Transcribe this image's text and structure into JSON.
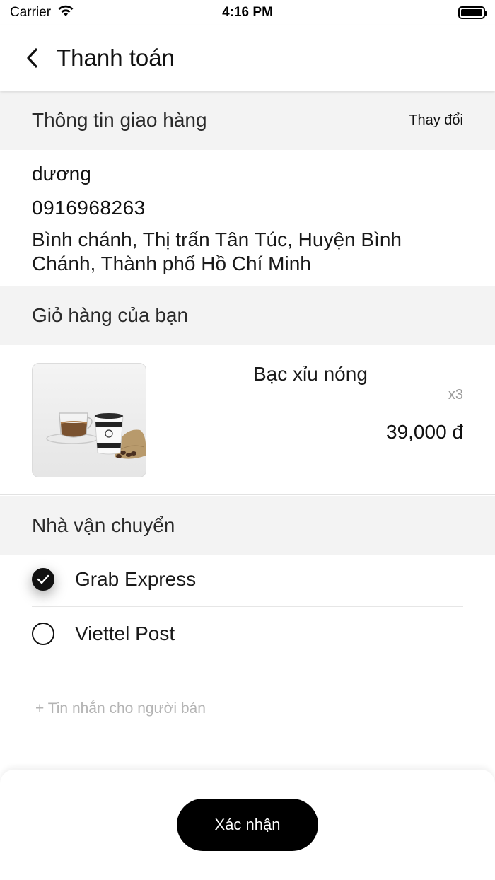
{
  "status_bar": {
    "carrier": "Carrier",
    "time": "4:16 PM"
  },
  "header": {
    "title": "Thanh toán"
  },
  "shipping": {
    "section_title": "Thông tin giao hàng",
    "change_label": "Thay đổi",
    "name": "dương",
    "phone": "0916968263",
    "address": "Bình chánh, Thị trấn Tân Túc, Huyện Bình Chánh, Thành phố Hồ Chí Minh"
  },
  "cart": {
    "section_title": "Giỏ hàng của bạn",
    "items": [
      {
        "name": "Bạc xỉu nóng",
        "quantity": "x3",
        "price": "39,000 đ"
      }
    ]
  },
  "carrier_section": {
    "section_title": "Nhà vận chuyển",
    "options": [
      {
        "label": "Grab Express",
        "selected": true
      },
      {
        "label": "Viettel Post",
        "selected": false
      }
    ]
  },
  "message": {
    "add_label": "+ Tin nhắn cho người bán"
  },
  "footer": {
    "confirm_label": "Xác nhận"
  }
}
